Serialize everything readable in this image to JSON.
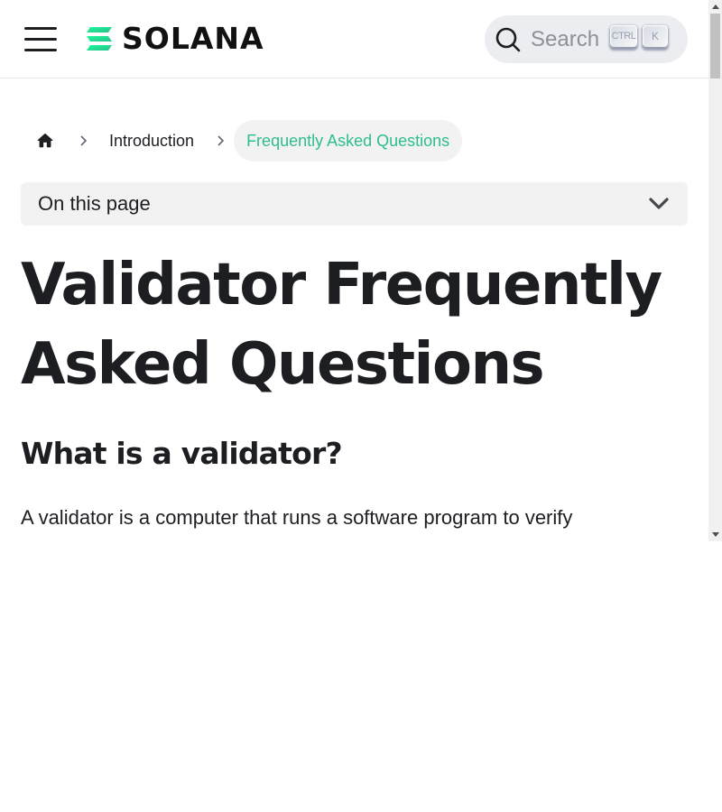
{
  "navbar": {
    "logo_text": "SOLANA",
    "search": {
      "placeholder": "Search",
      "shortcut_ctrl": "CTRL",
      "shortcut_key": "K"
    }
  },
  "breadcrumbs": {
    "home_icon": "home-icon",
    "items": [
      {
        "label": "Introduction"
      },
      {
        "label": "Frequently Asked Questions",
        "active": true
      }
    ]
  },
  "toc": {
    "label": "On this page"
  },
  "article": {
    "title": "Validator Frequently Asked Questions",
    "section_heading": "What is a validator?",
    "paragraph": "A validator is a computer that runs a software program to verify"
  },
  "colors": {
    "accent": "#2dbe8c",
    "breadcrumb_bg": "#f2f2f2",
    "search_bg": "#ebedf0",
    "text": "#1c1e21"
  }
}
